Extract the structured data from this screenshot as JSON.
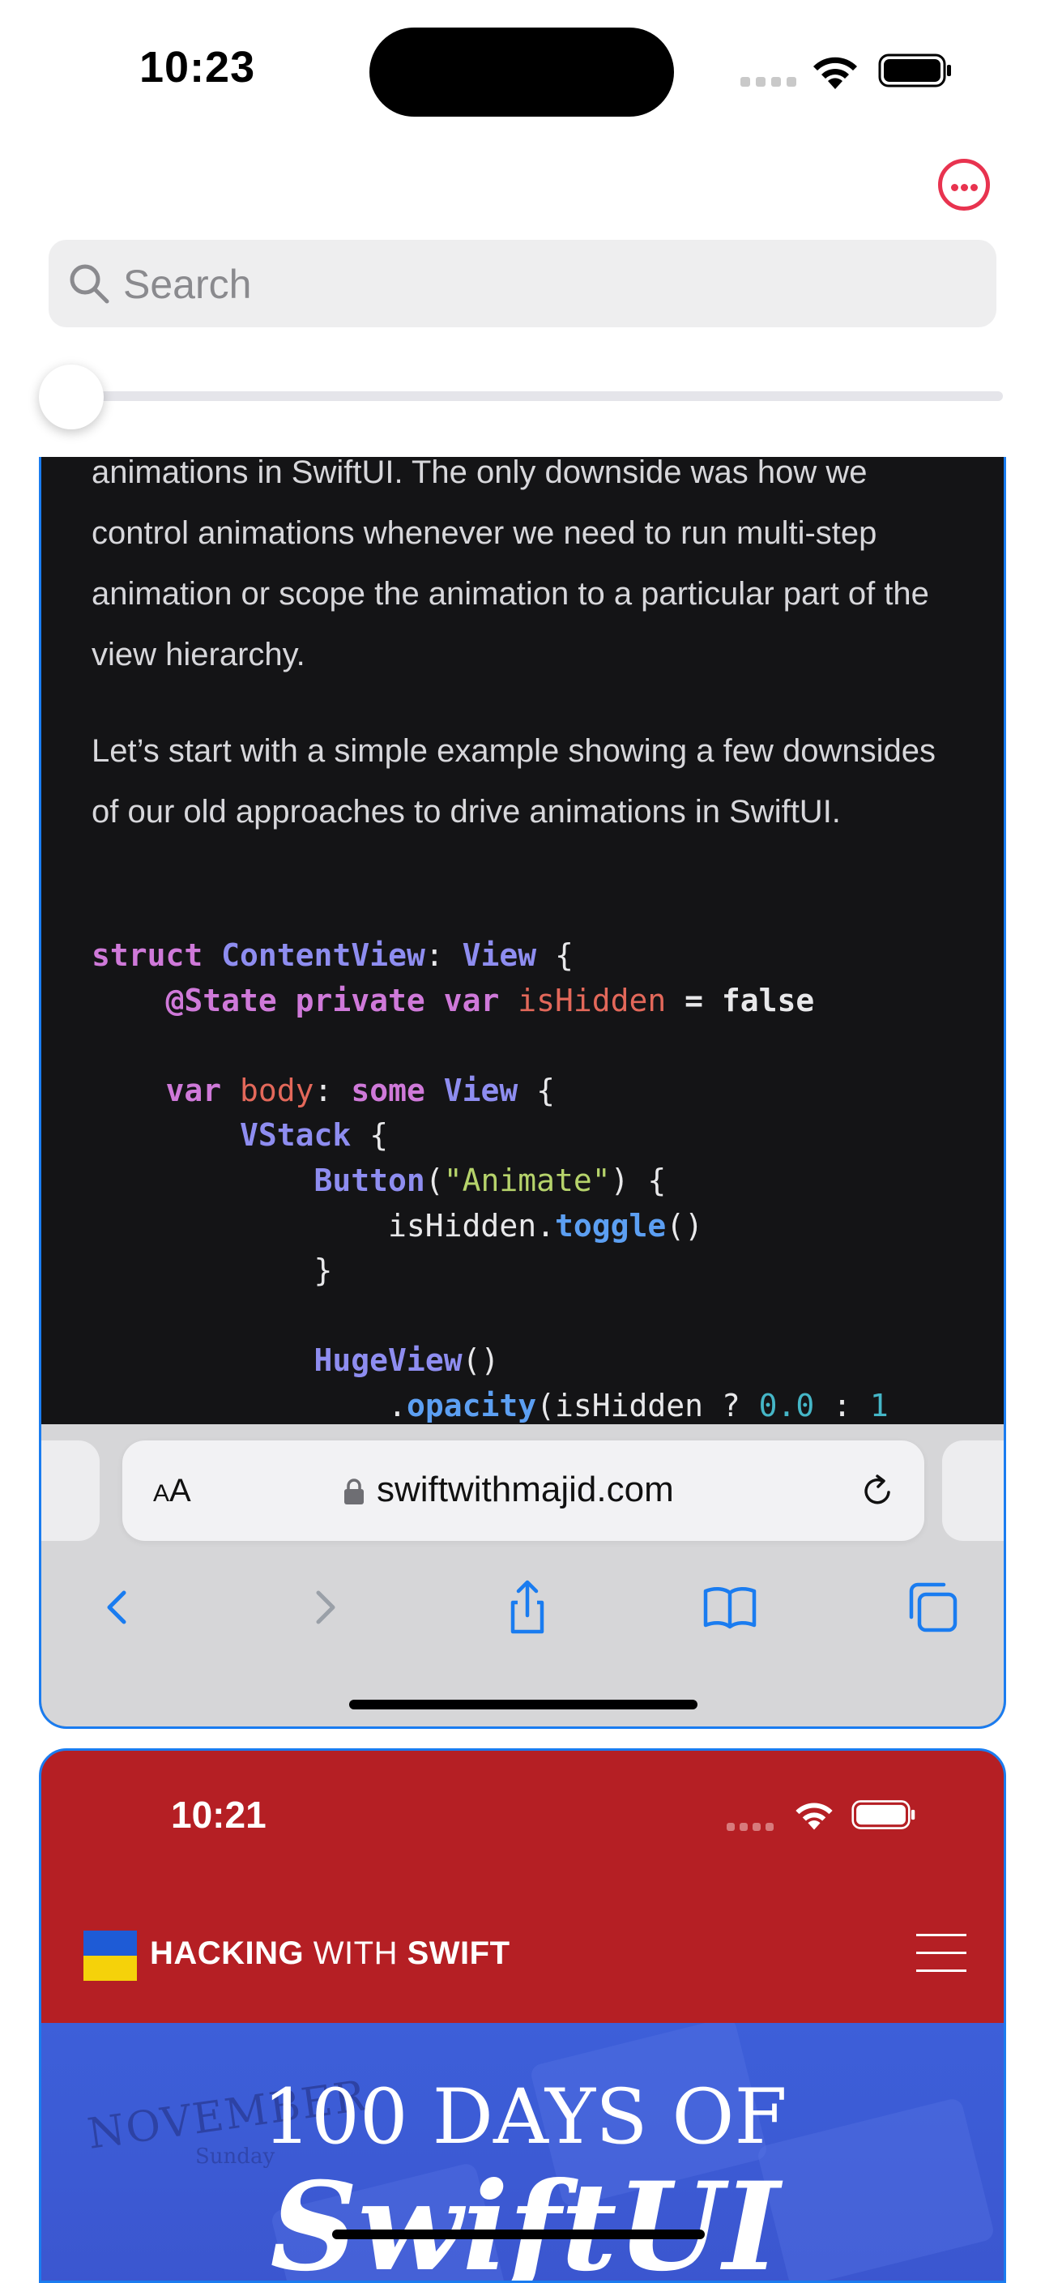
{
  "status_bar": {
    "time": "10:23"
  },
  "top": {
    "search": {
      "placeholder": "Search"
    },
    "slider": {
      "value": 0.0
    }
  },
  "tab1": {
    "article": {
      "paragraph_1": "animations in SwiftUI. The only downside was how we control animations whenever we need to run multi-step animation or scope the animation to a particular part of the view hierarchy.",
      "paragraph_2": "Let’s start with a simple example showing a few downsides of our old approaches to drive animations in SwiftUI."
    },
    "code": {
      "l1": {
        "a": "struct",
        "b": "ContentView",
        "c": ":",
        "d": "View",
        "e": "{"
      },
      "l2": {
        "a": "@State private var",
        "b": "isHidden",
        "c": "=",
        "d": "false"
      },
      "l3": {
        "a": "var",
        "b": "body",
        "c": ":",
        "d": "some",
        "e": "View",
        "f": "{"
      },
      "l4": {
        "a": "VStack",
        "b": "{"
      },
      "l5": {
        "a": "Button",
        "b": "(",
        "c": "\"Animate\"",
        "d": ") {"
      },
      "l6": {
        "a": "isHidden.",
        "b": "toggle",
        "c": "()"
      },
      "l7": {
        "a": "}"
      },
      "l8": {
        "a": "HugeView",
        "b": "()"
      },
      "l9": {
        "a": ".",
        "b": "opacity",
        "c": "(isHidden ? ",
        "d": "0.0",
        "e": " : ",
        "f": "1"
      }
    },
    "address_bar": {
      "text_size_a_small": "A",
      "text_size_a_large": "A",
      "url": "swiftwithmajid.com"
    },
    "nav": [
      "back-icon",
      "forward-icon",
      "share-icon",
      "bookmarks-icon",
      "tabs-icon"
    ]
  },
  "tab2": {
    "status_time": "10:21",
    "brand": {
      "part1": "HACKING",
      "part2": "WITH",
      "part3": "SWIFT"
    },
    "hero": {
      "title": "100 DAYS OF",
      "subtitle": "SwiftUI",
      "decor_1": "NOVEMBER",
      "decor_2": "Sunday"
    },
    "flag_colors": [
      "#1e5bd6",
      "#f5d20a"
    ]
  },
  "colors": {
    "accent": "#e8334f",
    "tab_border": "#1a7cf0",
    "tab2_bg": "#b51f24"
  }
}
